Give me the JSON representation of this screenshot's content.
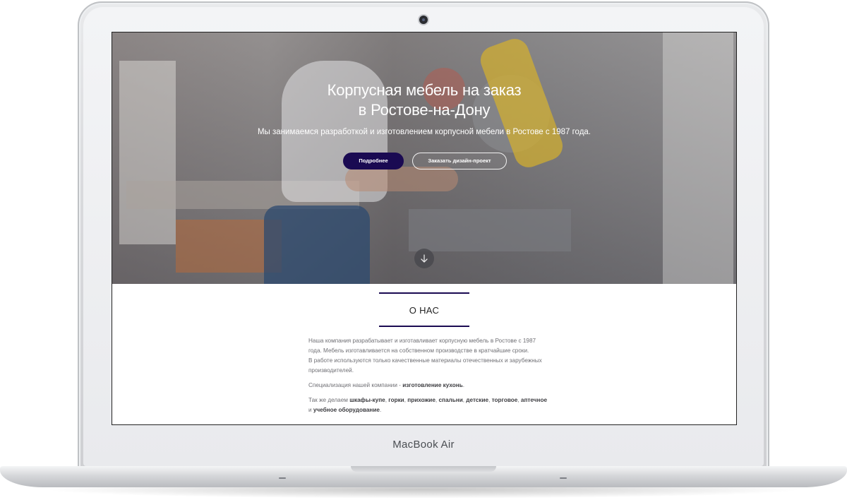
{
  "device": {
    "model_label": "MacBook Air"
  },
  "hero": {
    "title_line1": "Корпусная мебель на заказ",
    "title_line2": "в Ростове-на-Дону",
    "subtitle": "Мы занимаемся разработкой и изготовлением корпусной мебели в Ростове с 1987 года.",
    "button_more": "Подробнее",
    "button_design": "Заказать дизайн-проект",
    "scroll_icon": "arrow-down-icon"
  },
  "about": {
    "heading": "О НАС",
    "p1_line1": "Наша компания разрабатывает и изготавливает корпусную мебель в Ростове с 1987",
    "p1_line2": "года. Мебель изготавливается на собственном производстве в кратчайшие сроки.",
    "p1_line3": "В работе используются только качественные материалы отечественных и зарубежных",
    "p1_line4": "производителей.",
    "p2_prefix": "Специализация нашей компании - ",
    "p2_bold": "изготовление кухонь",
    "p2_suffix": ".",
    "p3_prefix": "Так же делаем ",
    "p3_bold1": "шкафы-купе",
    "p3_sep1": ", ",
    "p3_bold2": "горки",
    "p3_sep2": ", ",
    "p3_bold3": "прихожие",
    "p3_sep3": ", ",
    "p3_bold4": "спальни",
    "p3_sep4": ", ",
    "p3_bold5": "детские",
    "p3_sep5": ", ",
    "p3_bold6": "торговое",
    "p3_sep6": ", ",
    "p3_bold7": "аптечное",
    "p3_and": "и ",
    "p3_bold8": "учебное оборудование",
    "p3_suffix": "."
  },
  "colors": {
    "accent": "#1a0a52",
    "hero_text": "#ffffff",
    "body_text": "#6f6f74"
  }
}
